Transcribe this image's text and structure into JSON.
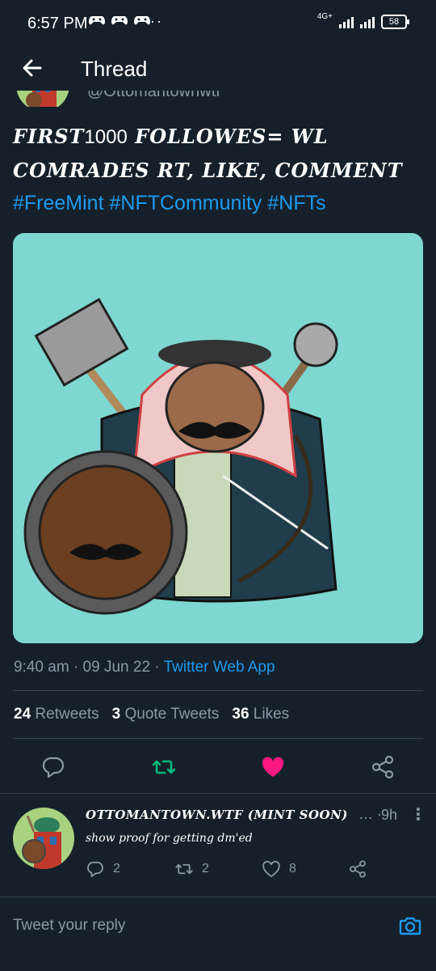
{
  "status_bar": {
    "time": "6:57 PM",
    "notification_icons": [
      "game-controller-icon",
      "game-controller-icon",
      "game-controller-icon"
    ],
    "more_dots": "··",
    "network_label": "4G+",
    "battery": "58"
  },
  "header": {
    "title": "Thread"
  },
  "tweet": {
    "author_handle_partial": "@Ottomantownwtf",
    "text_line1": "FIRST",
    "text_count": "1000",
    "text_line1b": " FOLLOWES= WL",
    "text_line2": "COMRADES RT, LIKE, COMMENT",
    "hashtags": [
      "#FreeMint",
      "#NFTCommunity",
      "#NFTs"
    ],
    "time": "9:40 am",
    "date": "09 Jun 22",
    "source": "Twitter Web App",
    "separator": "·"
  },
  "stats": {
    "retweets_count": "24",
    "retweets_label": "Retweets",
    "quotes_count": "3",
    "quotes_label": "Quote Tweets",
    "likes_count": "36",
    "likes_label": "Likes"
  },
  "reply": {
    "name": "OTTOMANTOWN.WTF (MINT SOON)",
    "ellipsis": "…",
    "separator": "·",
    "time": "9h",
    "more": "⋮",
    "text": "show proof for getting dm'ed",
    "reply_count": "2",
    "retweet_count": "2",
    "like_count": "8"
  },
  "composer": {
    "placeholder": "Tweet your reply"
  },
  "colors": {
    "background": "#15202b",
    "accent": "#1d9bf0",
    "retweet_active": "#00ba7c",
    "like_active": "#f91880",
    "muted": "#8b98a5",
    "image_bg": "#7ed7d1"
  }
}
